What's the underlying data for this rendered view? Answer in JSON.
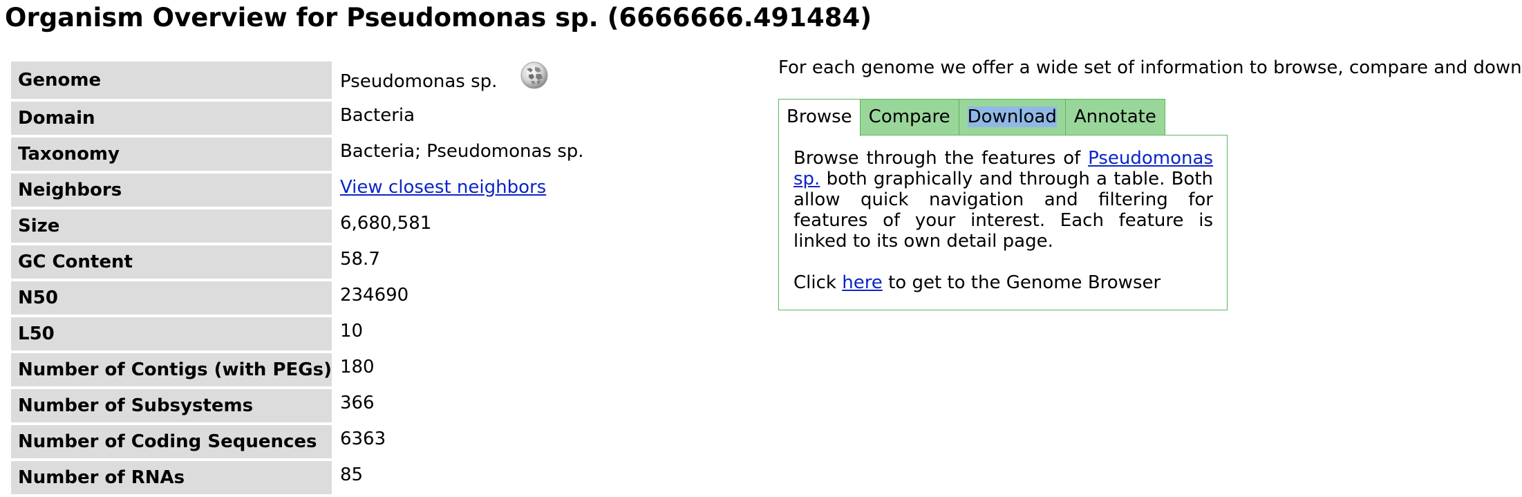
{
  "page": {
    "title": "Organism Overview for Pseudomonas sp. (6666666.491484)"
  },
  "overview": {
    "rows": [
      {
        "label": "Genome",
        "value": "Pseudomonas sp.",
        "icon": "wikipedia-globe-icon"
      },
      {
        "label": "Domain",
        "value": "Bacteria"
      },
      {
        "label": "Taxonomy",
        "value": "Bacteria; Pseudomonas sp."
      },
      {
        "label": "Neighbors",
        "value": "View closest neighbors",
        "is_link": true
      },
      {
        "label": "Size",
        "value": "6,680,581"
      },
      {
        "label": "GC Content",
        "value": "58.7"
      },
      {
        "label": "N50",
        "value": "234690"
      },
      {
        "label": "L50",
        "value": "10"
      },
      {
        "label": "Number of Contigs (with PEGs)",
        "value": "180"
      },
      {
        "label": "Number of Subsystems",
        "value": "366"
      },
      {
        "label": "Number of Coding Sequences",
        "value": "6363"
      },
      {
        "label": "Number of RNAs",
        "value": "85"
      }
    ]
  },
  "info": {
    "intro": "For each genome we offer a wide set of information to browse, compare and download.",
    "tabs": [
      {
        "label": "Browse",
        "active": true
      },
      {
        "label": "Compare",
        "active": false
      },
      {
        "label": "Download",
        "active": false,
        "highlighted": true
      },
      {
        "label": "Annotate",
        "active": false
      }
    ],
    "browse_panel": {
      "text_before_link": "Browse through the features of ",
      "organism_link": "Pseudomonas sp.",
      "text_after_link": " both graphically and through a table. Both allow quick navigation and filtering for features of your interest. Each feature is linked to its own detail page.",
      "click_prefix": "Click ",
      "here_link": "here",
      "click_suffix": " to get to the Genome Browser"
    }
  },
  "colors": {
    "label_background": "#dcdcdc",
    "tab_background": "#99d69a",
    "tab_border": "#5ab55a",
    "link": "#0b24c8",
    "text_selection": "#8fb8e6"
  }
}
